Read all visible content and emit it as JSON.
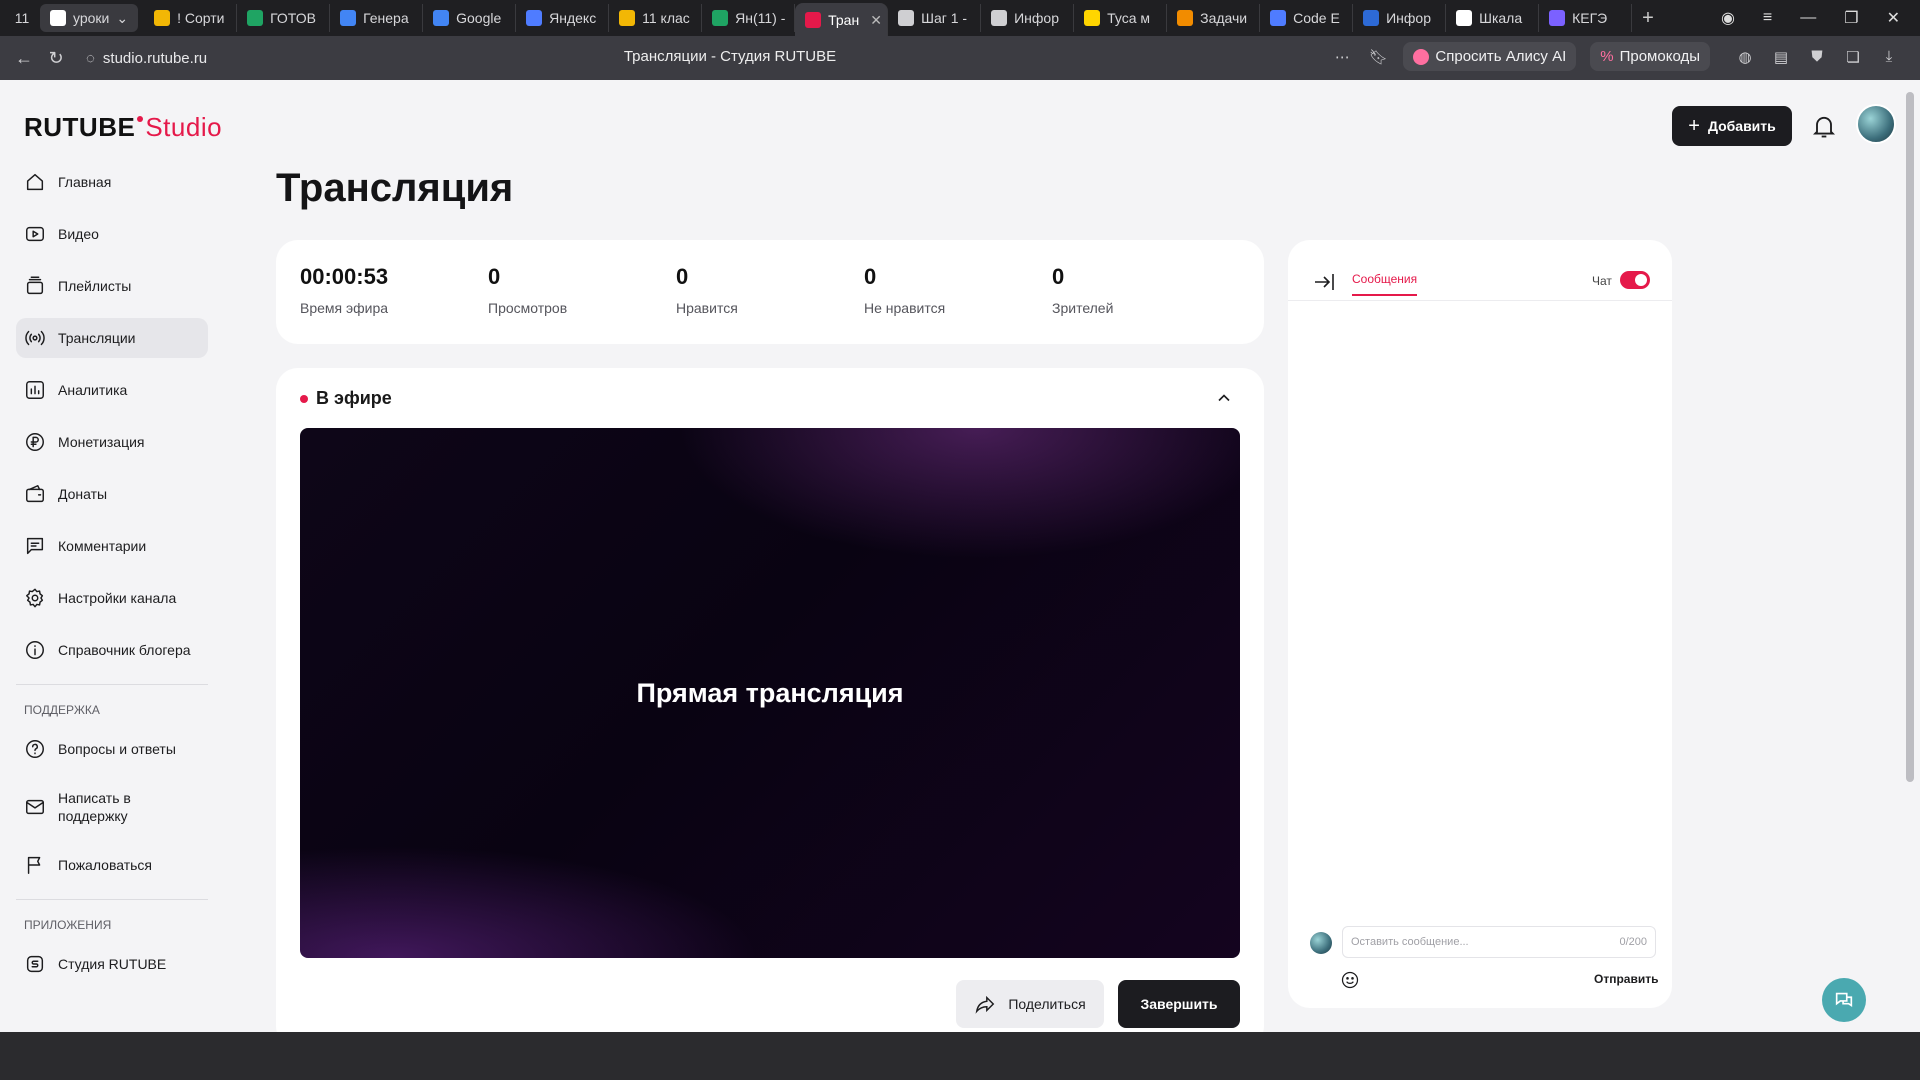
{
  "browser": {
    "tab_count": "11",
    "group_label": "уроки",
    "tabs": [
      {
        "label": "! Сорти",
        "color": "#f2b705"
      },
      {
        "label": "ГОТОВ",
        "color": "#1fa463"
      },
      {
        "label": "Генера",
        "color": "#4285f4"
      },
      {
        "label": "Google",
        "color": "#4285f4"
      },
      {
        "label": "Яндекс",
        "color": "#4f7cff"
      },
      {
        "label": "11 клас",
        "color": "#f2b705"
      },
      {
        "label": "Ян(11) -",
        "color": "#1fa463"
      },
      {
        "label": "Тран",
        "color": "#e5194a",
        "active": true
      },
      {
        "label": "Шаг 1 -",
        "color": "#cfcfd2"
      },
      {
        "label": "Инфор",
        "color": "#cfcfd2"
      },
      {
        "label": "Туса м",
        "color": "#ffd500"
      },
      {
        "label": "Задачи",
        "color": "#f28c00"
      },
      {
        "label": "Code E",
        "color": "#4f7cff"
      },
      {
        "label": "Инфор",
        "color": "#2d6ad6"
      },
      {
        "label": "Шкала",
        "color": "#ffffff"
      },
      {
        "label": "КЕГЭ",
        "color": "#7b61ff"
      }
    ],
    "url": "studio.rutube.ru",
    "page_title": "Трансляции - Студия RUTUBE",
    "alice_label": "Спросить Алису AI",
    "promo_label": "Промокоды"
  },
  "logo": {
    "ru": "RUTUBE",
    "studio": "Studio"
  },
  "header": {
    "add_label": "Добавить"
  },
  "sidebar": {
    "items": [
      {
        "label": "Главная",
        "icon": "home-icon"
      },
      {
        "label": "Видео",
        "icon": "video-icon"
      },
      {
        "label": "Плейлисты",
        "icon": "playlist-icon"
      },
      {
        "label": "Трансляции",
        "icon": "broadcast-icon",
        "active": true
      },
      {
        "label": "Аналитика",
        "icon": "analytics-icon"
      },
      {
        "label": "Монетизация",
        "icon": "ruble-icon"
      },
      {
        "label": "Донаты",
        "icon": "wallet-icon"
      },
      {
        "label": "Комментарии",
        "icon": "comment-icon"
      },
      {
        "label": "Настройки канала",
        "icon": "gear-icon"
      },
      {
        "label": "Справочник блогера",
        "icon": "info-icon"
      }
    ],
    "support_title": "ПОДДЕРЖКА",
    "support_items": [
      {
        "label": "Вопросы и ответы",
        "icon": "question-icon"
      },
      {
        "label": "Написать в поддержку",
        "icon": "mail-icon"
      },
      {
        "label": "Пожаловаться",
        "icon": "flag-icon"
      }
    ],
    "apps_title": "ПРИЛОЖЕНИЯ",
    "apps_items": [
      {
        "label": "Студия RUTUBE",
        "icon": "studio-icon"
      }
    ]
  },
  "main": {
    "title": "Трансляция",
    "stats": [
      {
        "value": "00:00:53",
        "label": "Время эфира"
      },
      {
        "value": "0",
        "label": "Просмотров"
      },
      {
        "value": "0",
        "label": "Нравится"
      },
      {
        "value": "0",
        "label": "Не нравится"
      },
      {
        "value": "0",
        "label": "Зрителей"
      }
    ],
    "live_label": "В эфире",
    "player_text": "Прямая трансляция",
    "share_label": "Поделиться",
    "end_label": "Завершить"
  },
  "chat": {
    "tab_label": "Сообщения",
    "toggle_label": "Чат",
    "toggle_on": true,
    "input_placeholder": "Оставить сообщение...",
    "counter": "0/200",
    "send_label": "Отправить"
  },
  "colors": {
    "accent": "#e5194a",
    "dark": "#1c1c20"
  }
}
